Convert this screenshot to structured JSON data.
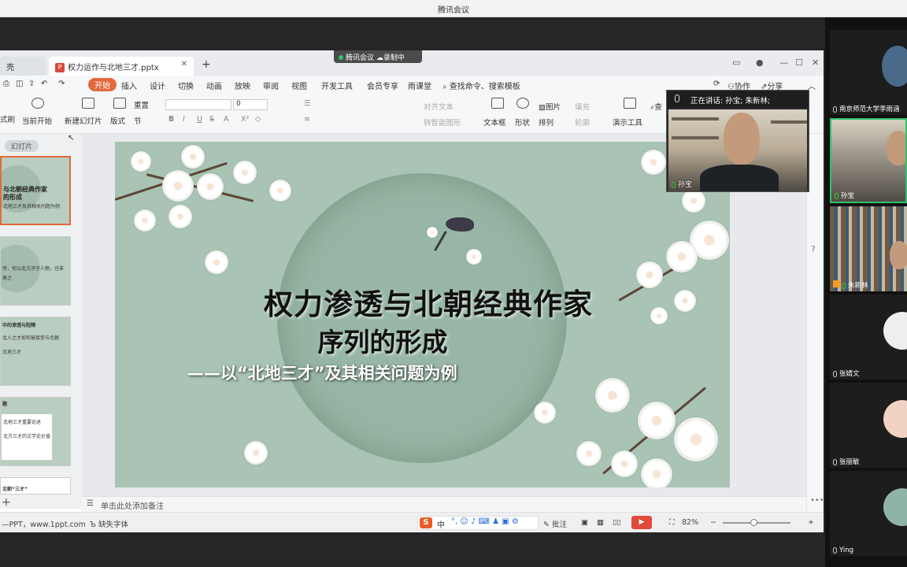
{
  "meeting": {
    "window_title": "腾讯会议",
    "recording_badge": {
      "app": "腾讯会议",
      "recording": "录制中"
    },
    "speaking_prefix": "正在讲话: 孙宝; 朱新林;",
    "speaker_name": "孙宝",
    "participants": [
      {
        "name": "南京师范大学李雨涵",
        "active": false
      },
      {
        "name": "孙宝",
        "active": true
      },
      {
        "name": "朱新林",
        "active": false
      },
      {
        "name": "张婧文",
        "active": false
      },
      {
        "name": "张丽敏",
        "active": false
      },
      {
        "name": "Ying",
        "active": false
      }
    ]
  },
  "wps": {
    "tabs": {
      "home": "壳",
      "document": "权力运作与北地三才.pptx",
      "add": "+"
    },
    "menu": [
      "开始",
      "插入",
      "设计",
      "切换",
      "动画",
      "放映",
      "审阅",
      "视图",
      "开发工具",
      "会员专享",
      "雨课堂"
    ],
    "search": "查找命令、搜索模板",
    "top_right": {
      "collab": "协作",
      "share": "分享"
    },
    "toolbar": {
      "format_painter": "式刷",
      "from_current": "当前开始",
      "new_slide": "新建幻灯片",
      "layout": "版式",
      "reset": "重置",
      "section": "节",
      "font_size": "0",
      "align_text": "对齐文本",
      "smartart": "转智能图形",
      "textbox": "文本框",
      "shape": "形状",
      "arrange": "排列",
      "picture": "图片",
      "fill": "填充",
      "outline": "轮廓",
      "present_tools": "演示工具",
      "find": "查"
    },
    "thumbs_label": "幻灯片",
    "thumbnails": [
      {
        "line1": "与北朝经典作家",
        "line2": "的形成",
        "line3": "北地三才及其相关问题为例"
      },
      {
        "line1": "",
        "line2": "序，何以北方济于人物，也非",
        "line3": "典之"
      },
      {
        "line1": "中的渗透与阻隔",
        "line2": "北人之才如何被接受与北朝",
        "line3": "北地三才"
      },
      {
        "line1": "题",
        "line2": "北地三才重要论述",
        "line3": "北方三才的文学史价值"
      },
      {
        "line1": "北朝“三才”",
        "line2": "",
        "line3": ""
      }
    ],
    "slide": {
      "title_line1": "权力渗透与北朝经典作家",
      "title_line2": "序列的形成",
      "subtitle": "——以“北地三才”及其相关问题为例"
    },
    "notes_placeholder": "单击此处添加备注",
    "status": {
      "template_source": "—PPT，www.1ppt.com",
      "missing_font": "缺失字体",
      "ime": "中",
      "comment": "批注",
      "zoom": "82%"
    }
  },
  "colors": {
    "accent_orange": "#e26a3c",
    "slide_bg": "#a9c4b4",
    "active_green": "#2ec36b"
  }
}
